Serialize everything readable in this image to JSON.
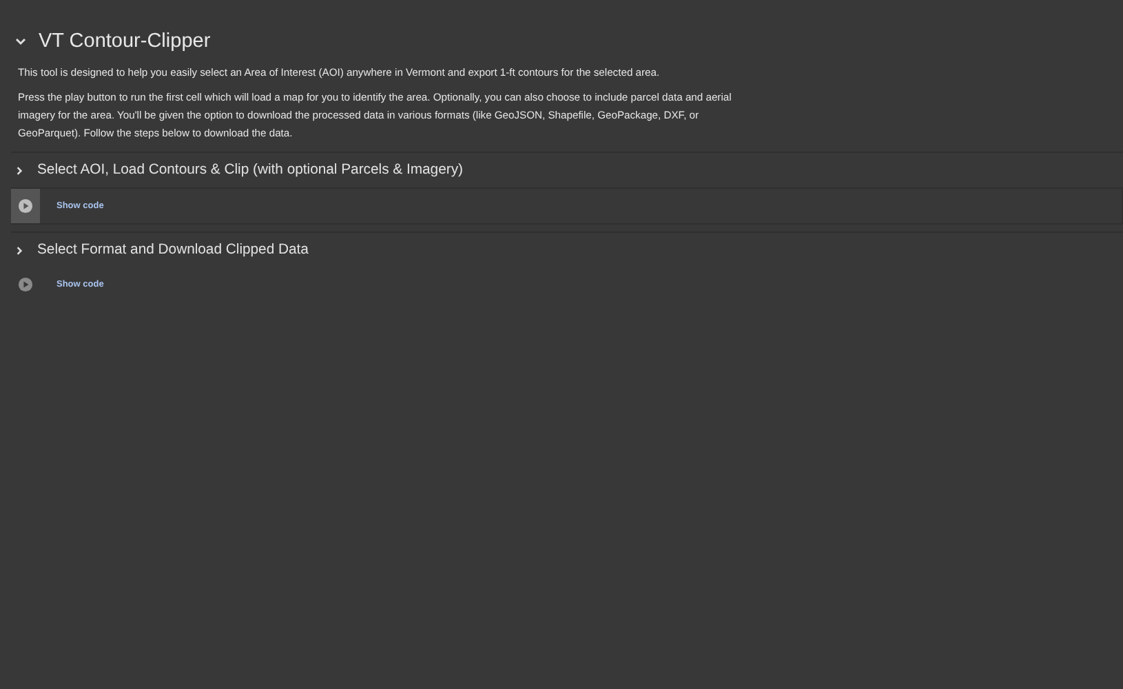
{
  "heading": {
    "title": "VT Contour-Clipper",
    "expanded": true
  },
  "paragraphs": [
    "This tool is designed to help you easily select an Area of Interest (AOI) anywhere in Vermont and export 1-ft contours for the selected area.",
    "Press the play button to run the first cell which will load a map for you to identify the area. Optionally, you can also choose to include parcel data and aerial imagery for the area. You'll be given the option to download the processed data in various formats (like GeoJSON, Shapefile, GeoPackage, DXF, or GeoParquet). Follow the steps below to download the data."
  ],
  "sections": [
    {
      "title": "Select AOI, Load Contours & Clip (with optional Parcels & Imagery)",
      "expanded": false,
      "selected": true,
      "link": "Show code"
    },
    {
      "title": "Select Format and Download Clipped Data",
      "expanded": false,
      "selected": false,
      "link": "Show code"
    }
  ]
}
